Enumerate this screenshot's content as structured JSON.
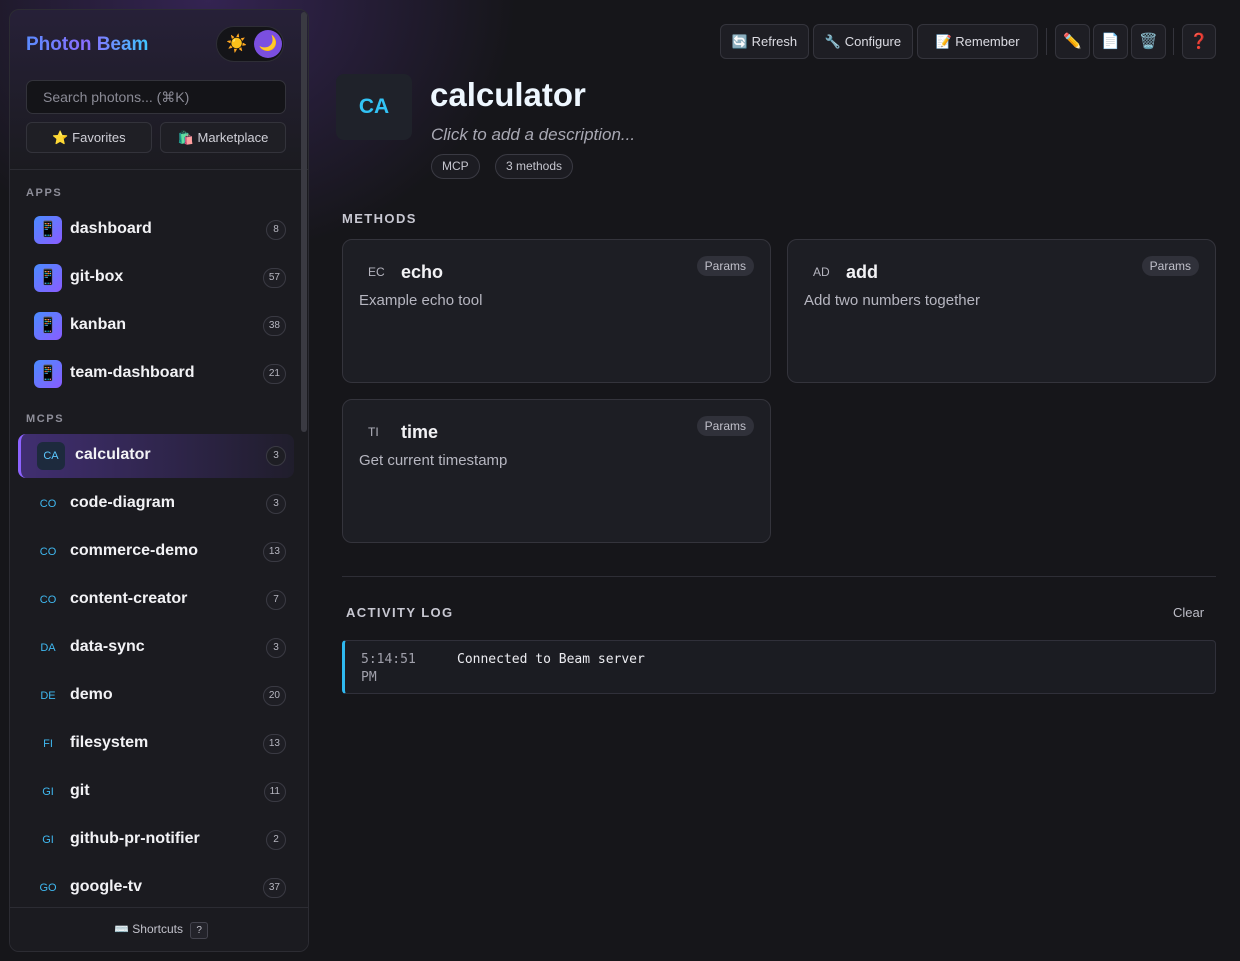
{
  "sidebar": {
    "brand": "Photon Beam",
    "theme": {
      "sun_icon": "☀️",
      "moon_icon": "🌙"
    },
    "search_placeholder": "Search photons... (⌘K)",
    "favorites_label": "⭐ Favorites",
    "marketplace_label": "🛍️ Marketplace",
    "apps_heading": "APPS",
    "apps": [
      {
        "label": "dashboard",
        "count": "8"
      },
      {
        "label": "git-box",
        "count": "57"
      },
      {
        "label": "kanban",
        "count": "38"
      },
      {
        "label": "team-dashboard",
        "count": "21"
      }
    ],
    "app_icon": "📱",
    "mcps_heading": "MCPS",
    "mcps": [
      {
        "abbr": "CA",
        "label": "calculator",
        "count": "3"
      },
      {
        "abbr": "CO",
        "label": "code-diagram",
        "count": "3"
      },
      {
        "abbr": "CO",
        "label": "commerce-demo",
        "count": "13"
      },
      {
        "abbr": "CO",
        "label": "content-creator",
        "count": "7"
      },
      {
        "abbr": "DA",
        "label": "data-sync",
        "count": "3"
      },
      {
        "abbr": "DE",
        "label": "demo",
        "count": "20"
      },
      {
        "abbr": "FI",
        "label": "filesystem",
        "count": "13"
      },
      {
        "abbr": "GI",
        "label": "git",
        "count": "11"
      },
      {
        "abbr": "GI",
        "label": "github-pr-notifier",
        "count": "2"
      },
      {
        "abbr": "GO",
        "label": "google-tv",
        "count": "37"
      }
    ],
    "shortcuts_label": "⌨️ Shortcuts",
    "shortcuts_key": "?"
  },
  "toolbar": {
    "refresh": "🔄 Refresh",
    "configure": "🔧 Configure",
    "remember": "📝 Remember",
    "edit_icon": "✏️",
    "file_icon": "📄",
    "trash_icon": "🗑️",
    "help_icon": "❓"
  },
  "header": {
    "avatar": "CA",
    "title": "calculator",
    "description": "Click to add a description...",
    "tags": [
      "MCP",
      "3 methods"
    ]
  },
  "methods": {
    "heading": "METHODS",
    "items": [
      {
        "abbr": "EC",
        "name": "echo",
        "description": "Example echo tool",
        "badge": "Params"
      },
      {
        "abbr": "AD",
        "name": "add",
        "description": "Add two numbers together",
        "badge": "Params"
      },
      {
        "abbr": "TI",
        "name": "time",
        "description": "Get current timestamp",
        "badge": "Params"
      }
    ]
  },
  "activity": {
    "heading": "ACTIVITY LOG",
    "clear_label": "Clear",
    "entries": [
      {
        "time": "5:14:51 PM",
        "message": "Connected to Beam server"
      }
    ]
  },
  "colors": {
    "accent": "#8d63ff",
    "cyan": "#32c3f5",
    "background": "#16161a"
  }
}
